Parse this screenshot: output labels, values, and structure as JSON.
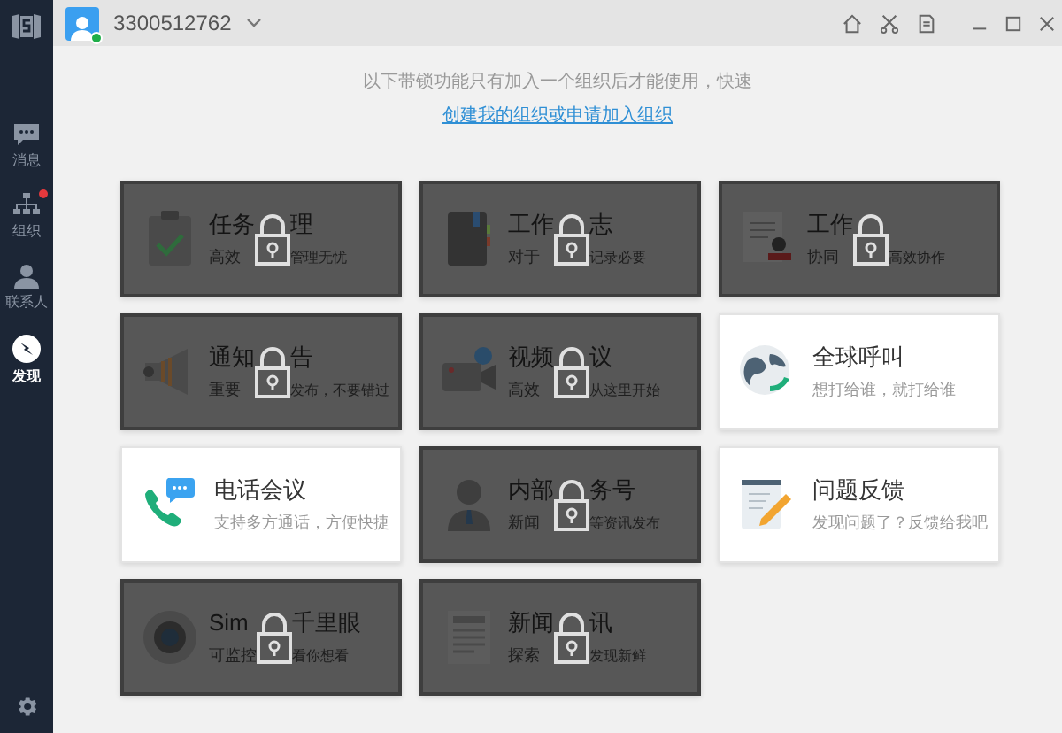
{
  "account": {
    "number": "3300512762"
  },
  "notice": {
    "text": "以下带锁功能只有加入一个组织后才能使用，快速",
    "link": "创建我的组织或申请加入组织"
  },
  "sidebar": {
    "items": [
      {
        "label": "消息",
        "kind": "chat",
        "selected": false,
        "dot": false
      },
      {
        "label": "组织",
        "kind": "org",
        "selected": false,
        "dot": true
      },
      {
        "label": "联系人",
        "kind": "person",
        "selected": false,
        "dot": false
      },
      {
        "label": "发现",
        "kind": "compass",
        "selected": true,
        "dot": false
      }
    ]
  },
  "cards": [
    {
      "title_parts": [
        "任务",
        "理"
      ],
      "description_parts": [
        "高效",
        "管理无忧"
      ],
      "kind": "clipboard",
      "locked": true
    },
    {
      "title_parts": [
        "工作",
        "志"
      ],
      "description_parts": [
        "对于",
        "记录必要"
      ],
      "kind": "notebook",
      "locked": true
    },
    {
      "title_parts": [
        "工作"
      ],
      "description_parts": [
        "协同",
        "高效协作"
      ],
      "kind": "stamp",
      "locked": true
    },
    {
      "title_parts": [
        "通知",
        "告"
      ],
      "description_parts": [
        "重要",
        "发布，不要错过"
      ],
      "kind": "megaphone",
      "locked": true
    },
    {
      "title_parts": [
        "视频",
        "议"
      ],
      "description_parts": [
        "高效",
        "从这里开始"
      ],
      "kind": "camera",
      "locked": true
    },
    {
      "title": "全球呼叫",
      "description": "想打给谁，就打给谁",
      "kind": "globe",
      "locked": false
    },
    {
      "title": "电话会议",
      "description": "支持多方通话，方便快捷",
      "kind": "phone",
      "locked": false
    },
    {
      "title_parts": [
        "内部",
        "务号"
      ],
      "description_parts": [
        "新闻",
        "等资讯发布"
      ],
      "kind": "person",
      "locked": true
    },
    {
      "title": "问题反馈",
      "description": "发现问题了？反馈给我吧",
      "kind": "note",
      "locked": false
    },
    {
      "title_parts": [
        "Sim",
        "千里眼"
      ],
      "description_parts": [
        "可监控",
        "看你想看"
      ],
      "kind": "eye",
      "locked": true
    },
    {
      "title_parts": [
        "新闻",
        "讯"
      ],
      "description_parts": [
        "探索",
        "发现新鲜"
      ],
      "kind": "news",
      "locked": true
    }
  ]
}
